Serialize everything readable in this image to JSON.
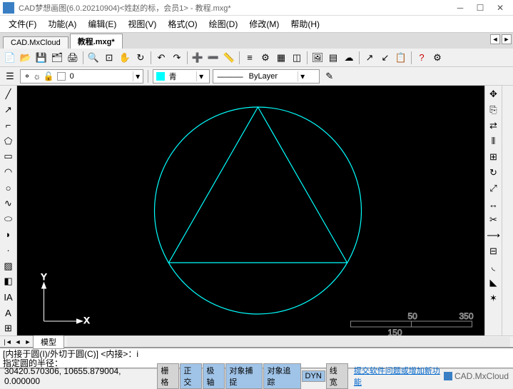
{
  "window": {
    "title": "CAD梦想画图(6.0.20210904)<姓赵的标，会员1> - 教程.mxg*"
  },
  "menu": [
    "文件(F)",
    "功能(A)",
    "编辑(E)",
    "视图(V)",
    "格式(O)",
    "绘图(D)",
    "修改(M)",
    "帮助(H)"
  ],
  "tabs": {
    "items": [
      "CAD.MxCloud",
      "教程.mxg*"
    ],
    "active": 1
  },
  "layer": {
    "name": "0",
    "color_label": "青",
    "linetype": "ByLayer"
  },
  "model_tab": "模型",
  "command": {
    "line1": "[内接于圆(I)/外切于圆(C)] <内接>：i",
    "line2": "指定圆的半径："
  },
  "status": {
    "coords": "30420.570306, 10655.879004, 0.000000",
    "buttons": [
      "栅格",
      "正交",
      "极轴",
      "对象捕捉",
      "对象追踪",
      "DYN",
      "线宽"
    ],
    "active": [
      "正交",
      "极轴",
      "对象捕捉",
      "对象追踪",
      "DYN"
    ],
    "link": "提交软件问题或增加新功能",
    "brand": "CAD.MxCloud"
  },
  "axes": {
    "x": "X",
    "y": "Y"
  },
  "ruler": {
    "a": "50",
    "b": "150",
    "c": "350"
  }
}
